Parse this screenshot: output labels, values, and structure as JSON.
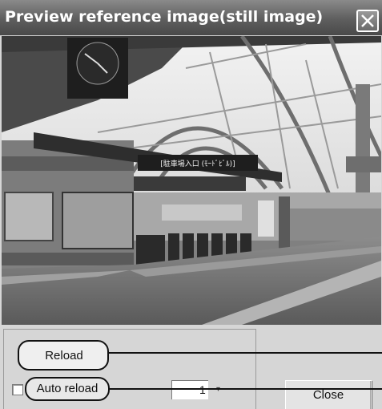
{
  "window": {
    "title": "Preview reference image(still image)"
  },
  "preview": {
    "sign_text": "[駐車場入口 (ﾓｰﾄﾞﾋﾞﾙ)]"
  },
  "controls": {
    "reload_label": "Reload",
    "auto_reload_label": "Auto reload",
    "auto_reload_checked": false,
    "interval_value": "1",
    "close_label": "Close"
  },
  "icons": {
    "title_close": "close-icon"
  }
}
